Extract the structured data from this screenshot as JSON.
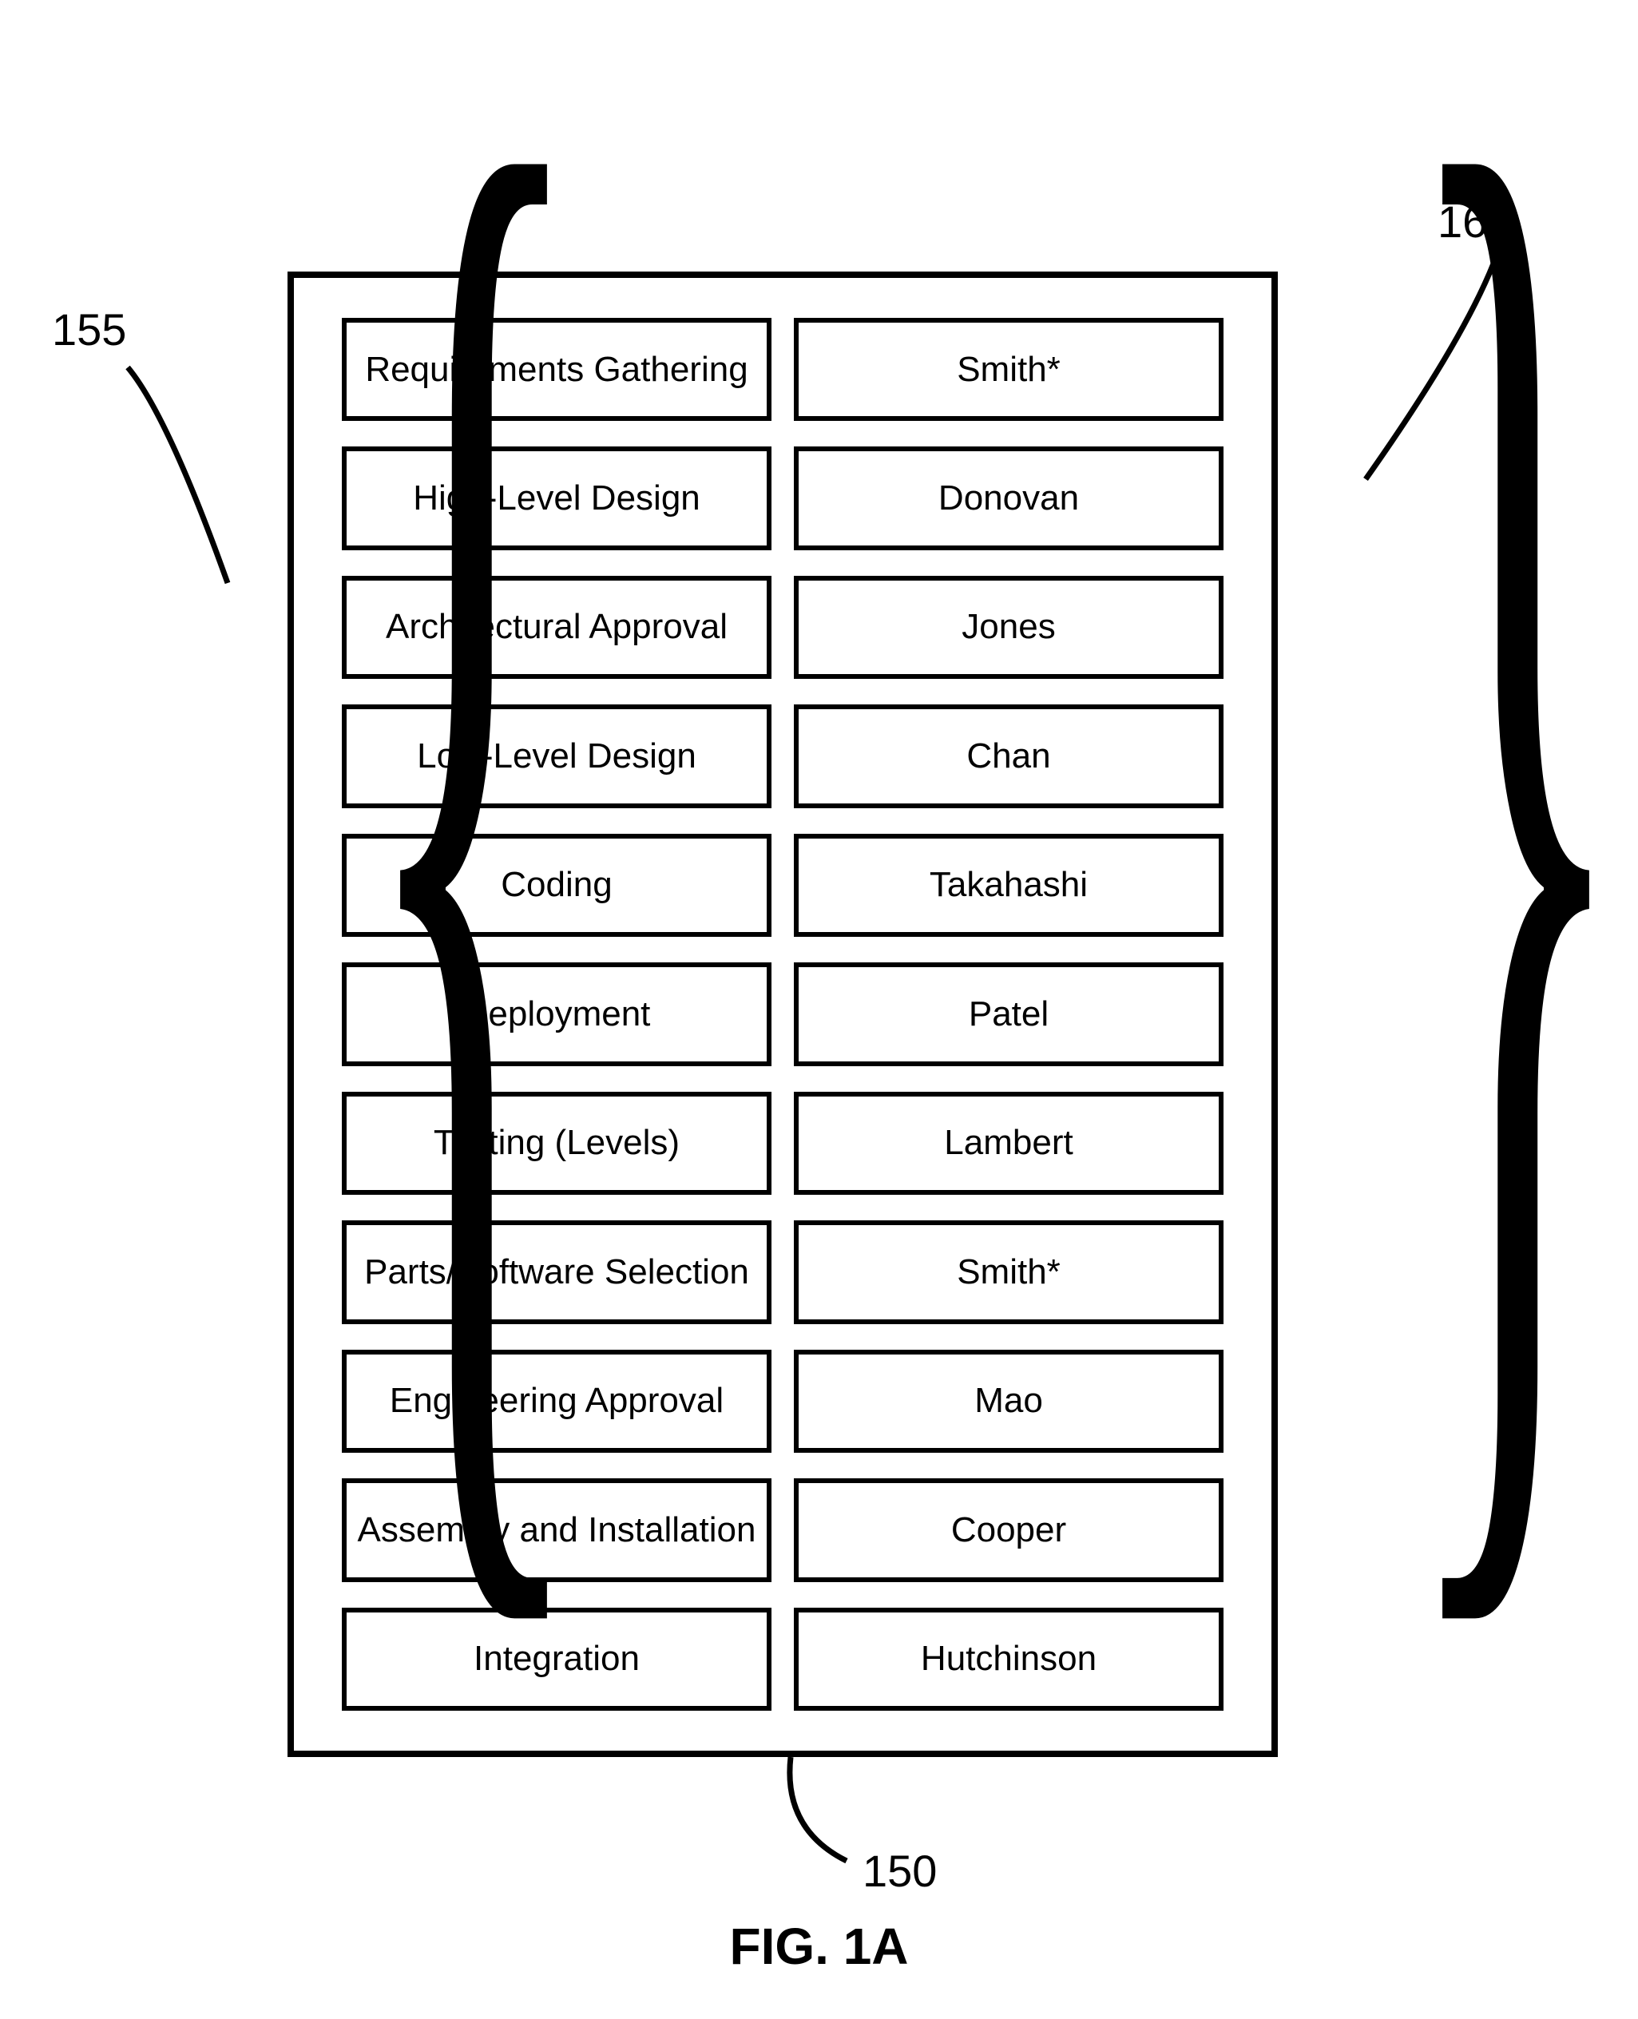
{
  "figure_label": "FIG. 1A",
  "callouts": {
    "box": "150",
    "left": "155",
    "right": "160"
  },
  "rows": [
    {
      "task": "Requirements Gathering",
      "person": "Smith*"
    },
    {
      "task": "High-Level Design",
      "person": "Donovan"
    },
    {
      "task": "Architectural Approval",
      "person": "Jones"
    },
    {
      "task": "Low-Level Design",
      "person": "Chan"
    },
    {
      "task": "Coding",
      "person": "Takahashi"
    },
    {
      "task": "Deployment",
      "person": "Patel"
    },
    {
      "task": "Testing (Levels)",
      "person": "Lambert"
    },
    {
      "task": "Parts/Software Selection",
      "person": "Smith*"
    },
    {
      "task": "Engineering Approval",
      "person": "Mao"
    },
    {
      "task": "Assembly and Installation",
      "person": "Cooper"
    },
    {
      "task": "Integration",
      "person": "Hutchinson"
    }
  ]
}
